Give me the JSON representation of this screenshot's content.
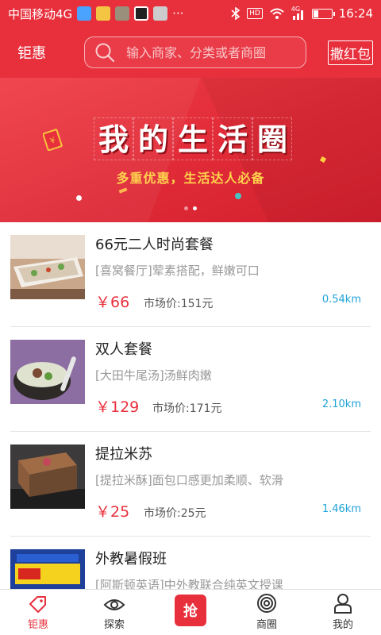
{
  "status_bar": {
    "carrier": "中国移动4G",
    "more": "···",
    "hd": "HD",
    "network": "4G",
    "time": "16:24",
    "battery_level": 0.3
  },
  "header": {
    "brand": "钜惠",
    "search_placeholder": "输入商家、分类或者商圈",
    "redpack_label": "撒红包"
  },
  "banner": {
    "title_chars": [
      "我",
      "的",
      "生",
      "活",
      "圈"
    ],
    "subtitle": "多重优惠，生活达人必备"
  },
  "items": [
    {
      "title": "66元二人时尚套餐",
      "desc": "[喜窝餐厅]荤素搭配，鲜嫩可口",
      "price": "￥66",
      "market": "市场价:151元",
      "distance": "0.54km"
    },
    {
      "title": "双人套餐",
      "desc": "[大田牛尾汤]汤鲜肉嫩",
      "price": "￥129",
      "market": "市场价:171元",
      "distance": "2.10km"
    },
    {
      "title": "提拉米苏",
      "desc": "[提拉米酥]面包口感更加柔顺、软滑",
      "price": "￥25",
      "market": "市场价:25元",
      "distance": "1.46km"
    },
    {
      "title": "外教暑假班",
      "desc": "[阿斯顿英语]中外教联合纯英文授课",
      "price": "",
      "market": "",
      "distance": ""
    }
  ],
  "tabs": {
    "t0": "钜惠",
    "t1": "探索",
    "grab": "抢",
    "t3": "商圈",
    "t4": "我的"
  },
  "colors": {
    "brand_red": "#e8303d",
    "distance_blue": "#1fa3d8",
    "subtitle_yellow": "#ffd34d"
  }
}
